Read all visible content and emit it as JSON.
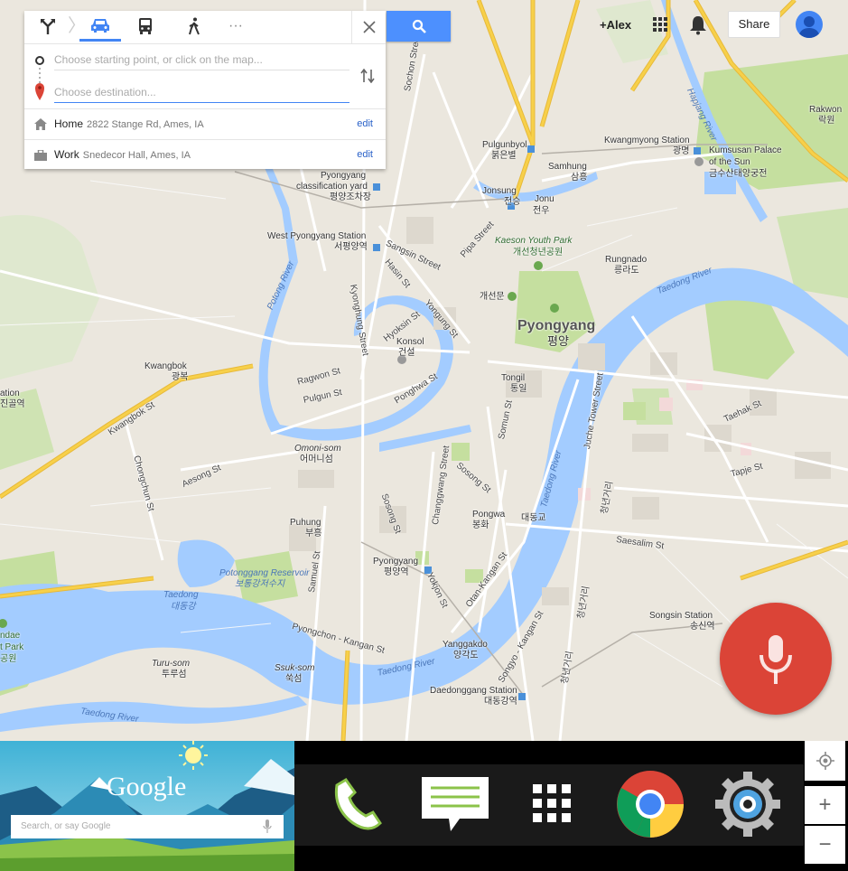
{
  "directions": {
    "modes": [
      {
        "name": "directions",
        "icon": "directions-icon"
      },
      {
        "name": "drive",
        "icon": "car-icon",
        "selected": true
      },
      {
        "name": "transit",
        "icon": "bus-icon"
      },
      {
        "name": "walk",
        "icon": "walk-icon"
      },
      {
        "name": "more",
        "icon": "more-icon"
      }
    ],
    "more_label": "···",
    "start_placeholder": "Choose starting point, or click on the map...",
    "dest_placeholder": "Choose destination...",
    "places": [
      {
        "name": "Home",
        "address": "2822 Stange Rd, Ames, IA",
        "edit": "edit",
        "icon": "home-icon"
      },
      {
        "name": "Work",
        "address": "Snedecor Hall, Ames, IA",
        "edit": "edit",
        "icon": "briefcase-icon"
      }
    ]
  },
  "topbar": {
    "user": "+Alex",
    "share": "Share"
  },
  "map_labels": {
    "pyongyang": "Pyongyang",
    "pyongyang_kr": "평양",
    "pulgunbyol": "Pulgunbyol",
    "pulgunbyol_kr": "붉은별",
    "kwangmyong_station": "Kwangmyong Station",
    "kwangmyong_kr": "광명",
    "kumsusan": "Kumsusan Palace",
    "of_the_sun": "of the Sun",
    "kumsusan_kr": "금수산태양궁전",
    "rakwon": "Rakwon",
    "rakwon_kr": "락원",
    "samhung": "Samhung",
    "samhung_kr": "삼흥",
    "jonsung": "Jonsung",
    "jonsung_kr": "전승",
    "jonu": "Jonu",
    "jonu_kr": "전우",
    "pyongyang_yard": "Pyongyang",
    "classification_yard": "classification yard",
    "yard_kr": "평양조차장",
    "west_station": "West Pyongyang Station",
    "west_station_kr": "서평양역",
    "kaeson_park": "Kaeson Youth Park",
    "kaeson_park_kr": "개선청년공원",
    "kaeson_kr": "개선문",
    "rungnado": "Rungnado",
    "rungnado_kr": "릉라도",
    "taedong_river": "Taedong River",
    "konsol": "Konsol",
    "konsol_kr": "건설",
    "tongil": "Tongil",
    "tongil_kr": "통일",
    "kwangbok": "Kwangbok",
    "kwangbok_kr": "광복",
    "kwangbok_st": "Kwangbok St",
    "ragwon_st": "Ragwon St",
    "pulgun_st": "Pulgun St",
    "ponghwa_st": "Ponghwa St",
    "hyoksin_st": "Hyoksin St",
    "yongung_st": "Yongung St",
    "sangsin_st": "Sangsin Street",
    "hasin_st": "Hasin St",
    "pipa_st": "Pipa Street",
    "sochon_st": "Sochon Street",
    "kyonghung_st": "Kyonghung Street",
    "potong_river": "Potong River",
    "hapjang_river": "Hapjang River",
    "omoni": "Omoni-som",
    "omoni_kr": "어머니섬",
    "aesong_st": "Aesong St",
    "chongchun_st": "Chongchun St",
    "changgwang_st": "Changgwang Street",
    "sosong_st": "Sosong St",
    "sosong_st2": "Sosong St",
    "somun_st": "Somun St",
    "juche_st": "Juche Tower Street",
    "taehak_st": "Taehak St",
    "tapje_st": "Tapje St",
    "saesalim_st": "Saesalim St",
    "pongwa": "Pongwa",
    "pongwa_kr": "봉화",
    "taedonggyo_kr": "대동교",
    "puhung": "Puhung",
    "puhung_kr": "부흥",
    "pyongyang_stn": "Pyongyang",
    "pyongyang_stn_kr": "평양역",
    "potonggang_res": "Potonggang Reservoir",
    "potonggang_kr": "보통강저수지",
    "taedong": "Taedong",
    "taedong_kr": "대동강",
    "samuel_st": "Samuel St",
    "yokjon_st": "Yokjon St",
    "otan_st": "Otan-Kangan St",
    "pyongchon_st": "Pyongchon - Kangan St",
    "taedong_river2": "Taedong River",
    "taedong_river3": "Taedong River",
    "yanggakdo": "Yanggakdo",
    "yanggakdo_kr": "양각도",
    "songyo_st": "Songyo - Kangan St",
    "chongnyon_kr": "청년거리",
    "chongnyon_kr2": "청년거리",
    "chongnyon_kr3": "청년거리",
    "songsin_station": "Songsin Station",
    "songsin_kr": "송신역",
    "turu": "Turu-som",
    "turu_kr": "투루섬",
    "ssuk": "Ssuk-som",
    "ssuk_kr": "쑥섬",
    "daedonggang_station": "Daedonggang Station",
    "daedonggang_kr": "대동강역",
    "ation": "ation",
    "ation_kr": "진골역",
    "ndae": "ndae",
    "t_park": "t Park",
    "park_kr": "공원"
  },
  "google_widget": {
    "logo": "Google",
    "search_placeholder": "Search, or say Google"
  },
  "dock_apps": [
    {
      "name": "phone",
      "icon": "phone-icon"
    },
    {
      "name": "messaging",
      "icon": "messaging-icon"
    },
    {
      "name": "apps",
      "icon": "app-drawer-icon"
    },
    {
      "name": "chrome",
      "icon": "chrome-icon"
    },
    {
      "name": "settings",
      "icon": "settings-icon"
    }
  ],
  "zoom": {
    "in": "+",
    "out": "−"
  },
  "colors": {
    "accent": "#4285f4",
    "search_button": "#4d90fe",
    "mic": "#db4437",
    "water": "#a3ccff",
    "park": "#c5df9f",
    "land": "#ebe7de",
    "highway": "#f7d04a"
  }
}
